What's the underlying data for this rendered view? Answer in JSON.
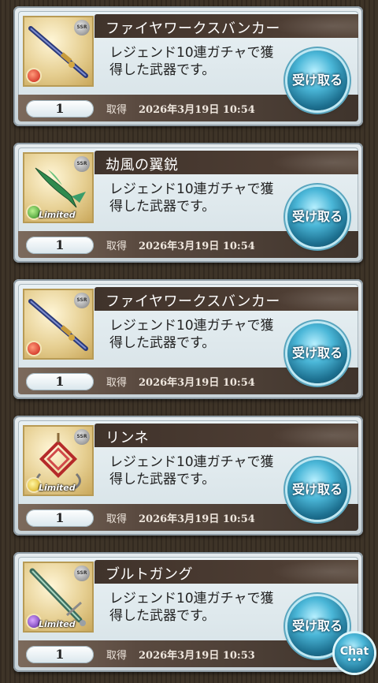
{
  "acquired_label": "取得",
  "receive_label": "受け取る",
  "chat_label": "Chat",
  "limited_label": "Limited",
  "ssp_label": "SSR",
  "items": [
    {
      "name": "ファイヤワークスバンカー",
      "desc_line1": "レジェンド10連ガチャで獲",
      "desc_line2": "得した武器です。",
      "quantity": "1",
      "date": "2026年3月19日 10:54",
      "element": "fire",
      "limited": false
    },
    {
      "name": "劫風の翼鋭",
      "desc_line1": "レジェンド10連ガチャで獲",
      "desc_line2": "得した武器です。",
      "quantity": "1",
      "date": "2026年3月19日 10:54",
      "element": "wind",
      "limited": true
    },
    {
      "name": "ファイヤワークスバンカー",
      "desc_line1": "レジェンド10連ガチャで獲",
      "desc_line2": "得した武器です。",
      "quantity": "1",
      "date": "2026年3月19日 10:54",
      "element": "fire",
      "limited": false
    },
    {
      "name": "リンネ",
      "desc_line1": "レジェンド10連ガチャで獲",
      "desc_line2": "得した武器です。",
      "quantity": "1",
      "date": "2026年3月19日 10:54",
      "element": "light",
      "limited": true
    },
    {
      "name": "ブルトガング",
      "desc_line1": "レジェンド10連ガチャで獲",
      "desc_line2": "得した武器です。",
      "quantity": "1",
      "date": "2026年3月19日 10:53",
      "element": "dark",
      "limited": true
    }
  ]
}
